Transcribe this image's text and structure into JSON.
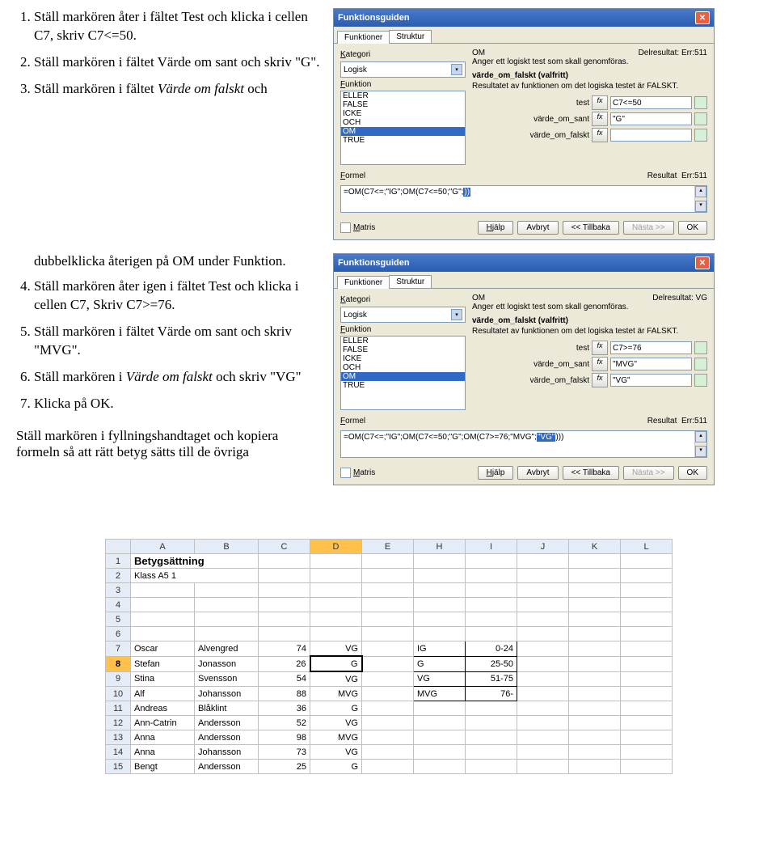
{
  "text": {
    "step1": "Ställ markören åter i fältet Test och klicka i cellen C7, skriv C7<=50.",
    "step2": "Ställ markören i fältet Värde om sant och skriv \"G\".",
    "step3_a": "Ställ markören i fältet ",
    "step3_i": "Värde om falskt",
    "step3_b": " och",
    "cont1": "dubbelklicka återigen på OM under Funktion.",
    "step4": "Ställ markören åter igen i fältet Test och klicka i cellen C7, Skriv C7>=76.",
    "step5": "Ställ markören i fältet Värde om sant och skriv \"MVG\".",
    "step6_a": "Ställ markören i ",
    "step6_i": "Värde om falskt",
    "step6_b": " och skriv \"VG\"",
    "step7": "Klicka på OK.",
    "footer": "Ställ markören i fyllningshandtaget och kopiera formeln så att rätt betyg sätts till de övriga"
  },
  "dlg1": {
    "title": "Funktionsguiden",
    "tab1": "Funktioner",
    "tab2": "Struktur",
    "lbl_kat": "Kategori",
    "kat_val": "Logisk",
    "lbl_funk": "Funktion",
    "funcs": [
      "ELLER",
      "FALSE",
      "ICKE",
      "OCH",
      "OM",
      "TRUE"
    ],
    "sel_func": "OM",
    "fname": "OM",
    "delres_lbl": "Delresultat:",
    "delres": "Err:511",
    "desc1": "Anger ett logiskt test som skall genomföras.",
    "optlbl": "värde_om_falskt (valfritt)",
    "desc2": "Resultatet av funktionen om det logiska testet är FALSKT.",
    "p_test": "test",
    "v_test": "C7<=50",
    "p_sant": "värde_om_sant",
    "v_sant": "\"G\"",
    "p_falskt": "värde_om_falskt",
    "v_falskt": "",
    "formel_lbl": "Formel",
    "res_lbl": "Resultat",
    "res": "Err:511",
    "formula_pre": "=OM(C7<=;\"IG\";OM(C7<=50;\"G\";",
    "formula_sel": "))",
    "chk": "Matris",
    "b_help": "Hjälp",
    "b_cancel": "Avbryt",
    "b_back": "<< Tillbaka",
    "b_next": "Nästa >>",
    "b_ok": "OK"
  },
  "dlg2": {
    "title": "Funktionsguiden",
    "delres": "VG",
    "v_test": "C7>=76",
    "v_sant": "\"MVG\"",
    "v_falskt": "\"VG\"",
    "res": "Err:511",
    "formula_pre": "=OM(C7<=;\"IG\";OM(C7<=50;\"G\";OM(C7>=76;\"MVG\";",
    "formula_sel": "\"VG\"",
    "formula_post": ")))"
  },
  "sheet": {
    "cols": [
      "A",
      "B",
      "C",
      "D",
      "E",
      "H",
      "I",
      "J",
      "K",
      "L"
    ],
    "title": "Betygsättning",
    "klass": "Klass A5 1",
    "rows": [
      {
        "n": 7,
        "a": "Oscar",
        "b": "Alvengred",
        "c": 74,
        "d": "VG"
      },
      {
        "n": 8,
        "a": "Stefan",
        "b": "Jonasson",
        "c": 26,
        "d": "G"
      },
      {
        "n": 9,
        "a": "Stina",
        "b": "Svensson",
        "c": 54,
        "d": "VG"
      },
      {
        "n": 10,
        "a": "Alf",
        "b": "Johansson",
        "c": 88,
        "d": "MVG"
      },
      {
        "n": 11,
        "a": "Andreas",
        "b": "Blåklint",
        "c": 36,
        "d": "G"
      },
      {
        "n": 12,
        "a": "Ann-Catrin",
        "b": "Andersson",
        "c": 52,
        "d": "VG"
      },
      {
        "n": 13,
        "a": "Anna",
        "b": "Andersson",
        "c": 98,
        "d": "MVG"
      },
      {
        "n": 14,
        "a": "Anna",
        "b": "Johansson",
        "c": 73,
        "d": "VG"
      },
      {
        "n": 15,
        "a": "Bengt",
        "b": "Andersson",
        "c": 25,
        "d": "G"
      }
    ],
    "grades": [
      {
        "g": "IG",
        "r": "0-24"
      },
      {
        "g": "G",
        "r": "25-50"
      },
      {
        "g": "VG",
        "r": "51-75"
      },
      {
        "g": "MVG",
        "r": "76-"
      }
    ]
  }
}
